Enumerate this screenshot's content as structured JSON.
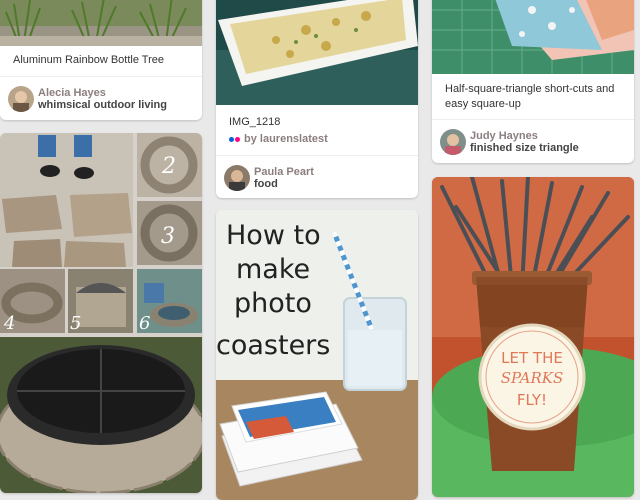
{
  "pins": [
    {
      "description": "Aluminum Rainbow Bottle Tree",
      "pinner": "Alecia Hayes",
      "board": "whimsical outdoor living"
    },
    {
      "description": "IMG_1218",
      "source_prefix": "by",
      "source": "laurenslatest",
      "pinner": "Paula Peart",
      "board": "food"
    },
    {
      "description": "Half-square-triangle short-cuts and easy square-up",
      "pinner": "Judy Haynes",
      "board": "finished size triangle"
    },
    {
      "image_title_lines": [
        "How to",
        "make",
        "photo",
        "coasters"
      ]
    },
    {
      "sign_lines": [
        "LET THE",
        "SPARKS",
        "FLY!"
      ]
    },
    {
      "step_numbers": [
        "2",
        "3",
        "4",
        "5",
        "6"
      ]
    }
  ],
  "colors": {
    "page_bg": "#e9e9e9",
    "card_bg": "#ffffff",
    "pinner_text": "#8c7e7e",
    "board_text": "#444444",
    "flickr_blue": "#0063dc",
    "flickr_pink": "#ff0084"
  },
  "icons": {
    "source_icon": "flickr-dots-icon"
  }
}
